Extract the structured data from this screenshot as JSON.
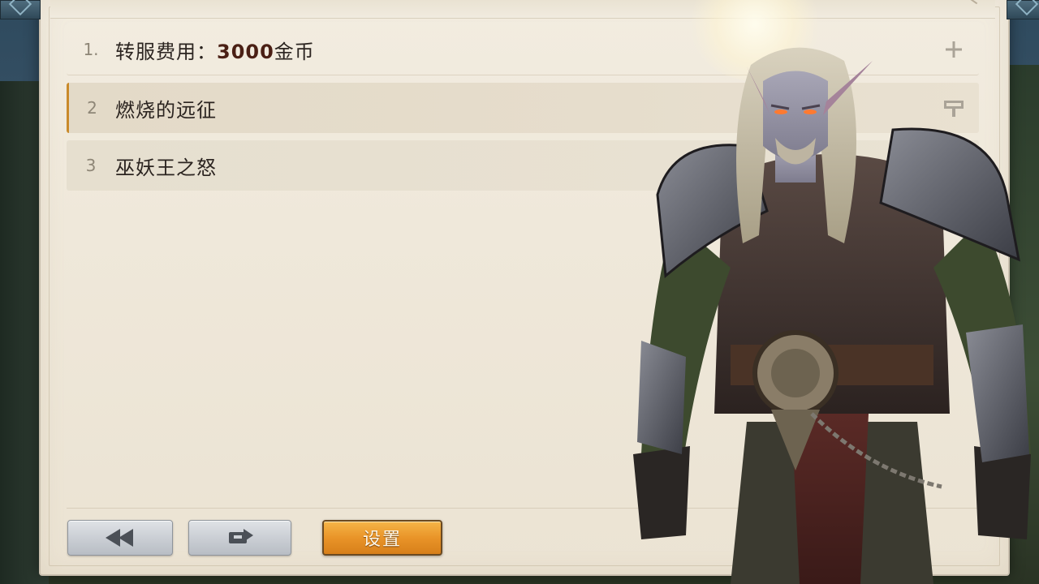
{
  "list": {
    "items": [
      {
        "number": "1.",
        "label_prefix": "转服费用：",
        "label_cost": "3000",
        "label_suffix": "金币",
        "action_icon": "plus-icon"
      },
      {
        "number": "2",
        "label": "燃烧的远征",
        "action_icon": "pin-icon",
        "selected": true
      },
      {
        "number": "3",
        "label": "巫妖王之怒"
      }
    ]
  },
  "toolbar": {
    "back_icon": "rewind-icon",
    "swap_icon": "swap-icon",
    "settings_label": "设置"
  },
  "colors": {
    "accent": "#c98a2a",
    "settings_button": "#e99428",
    "parchment": "#efe8da",
    "cost_text": "#4a1f14"
  }
}
